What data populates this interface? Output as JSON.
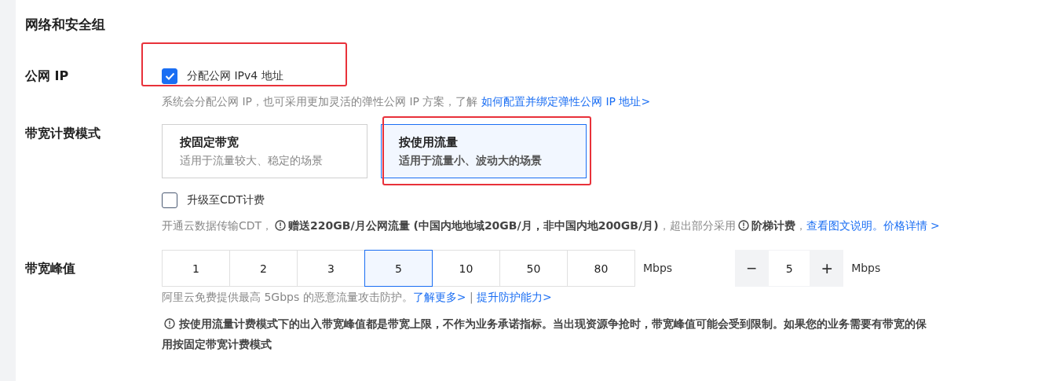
{
  "section_title": "网络和安全组",
  "public_ip": {
    "label": "公网 IP",
    "annotated": true,
    "checkbox": {
      "label": "分配公网 IPv4 地址",
      "checked": true
    },
    "hint": "系统会分配公网 IP，也可采用更加灵活的弹性公网 IP 方案，了解",
    "hint_link": "如何配置并绑定弹性公网 IP 地址>"
  },
  "billing": {
    "label": "带宽计费模式",
    "options": [
      {
        "title": "按固定带宽",
        "desc": "适用于流量较大、稳定的场景",
        "selected": false,
        "annotated": false
      },
      {
        "title": "按使用流量",
        "desc": "适用于流量小、波动大的场景",
        "selected": true,
        "annotated": true
      }
    ],
    "cdt": {
      "label": "升级至CDT计费",
      "checked": false
    },
    "cdt_note": [
      {
        "kind": "text",
        "text": "开通云数据传输CDT，"
      },
      {
        "kind": "notice",
        "text": "赠送220GB/月公网流量 (中国内地地域20GB/月，非中国内地200GB/月)"
      },
      {
        "kind": "text",
        "text": "，超出部分采用"
      },
      {
        "kind": "notice",
        "text": "阶梯计费",
        "after": "，"
      },
      {
        "kind": "link",
        "text": "查看图文说明。"
      },
      {
        "kind": "link",
        "text": "价格详情 >"
      }
    ]
  },
  "peak": {
    "label": "带宽峰值",
    "options": [
      {
        "label": "1",
        "selected": false
      },
      {
        "label": "2",
        "selected": false
      },
      {
        "label": "3",
        "selected": false
      },
      {
        "label": "5",
        "selected": true
      },
      {
        "label": "10",
        "selected": false
      },
      {
        "label": "50",
        "selected": false
      },
      {
        "label": "80",
        "selected": false
      }
    ],
    "unit": "Mbps",
    "stepper": {
      "minus": "−",
      "value": "5",
      "plus": "+",
      "unit": "Mbps"
    },
    "hint": "阿里云免费提供最高 5Gbps 的恶意流量攻击防护。",
    "links": [
      "了解更多>",
      "提升防护能力>"
    ],
    "separator": "|",
    "warning_lines": [
      "按使用流量计费模式下的出入带宽峰值都是带宽上限，不作为业务承诺指标。当出现资源争抢时，带宽峰值可能会受到限制。如果您的业务需要有带宽的保",
      "用按固定带宽计费模式"
    ]
  }
}
